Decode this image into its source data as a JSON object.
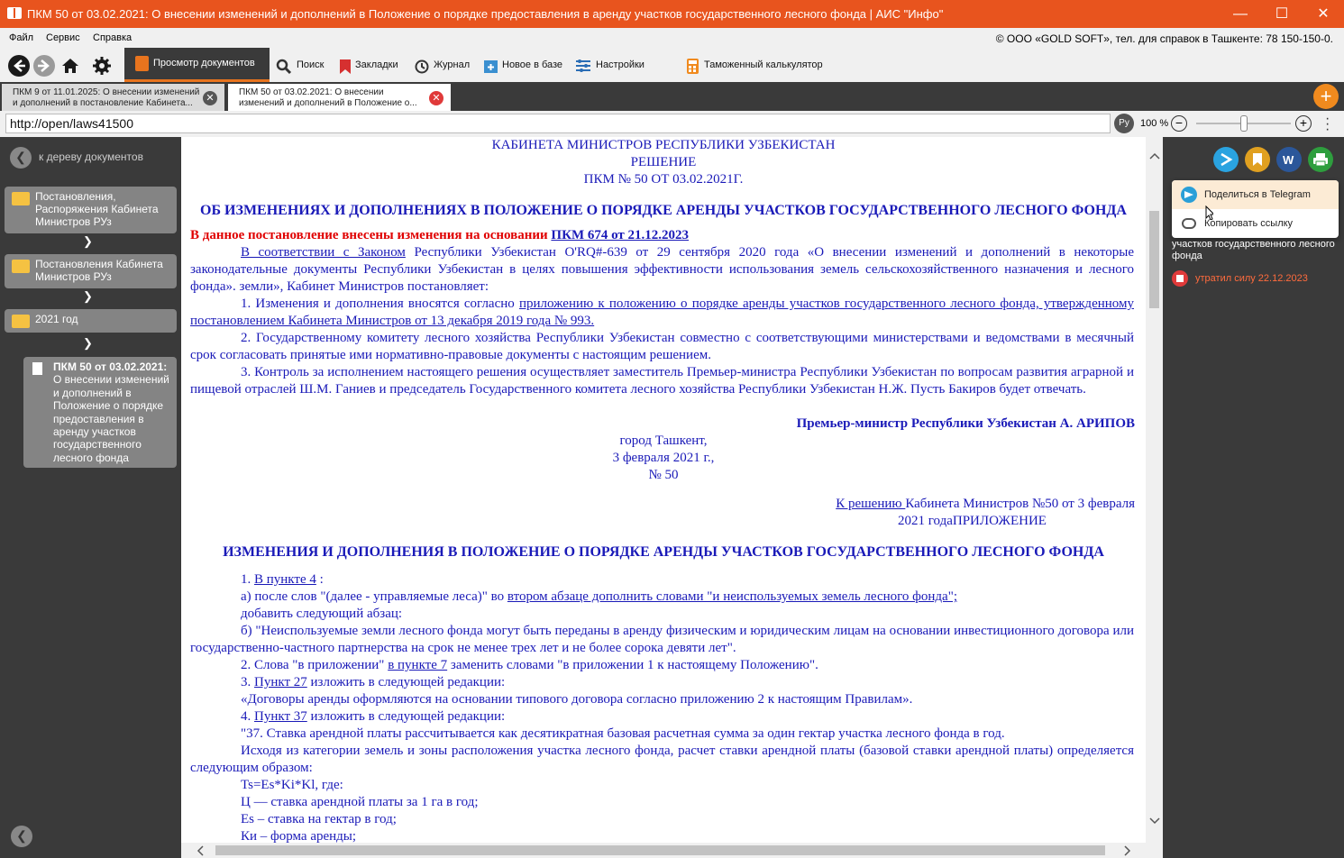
{
  "window": {
    "title": "ПКМ 50 от 03.02.2021: О внесении изменений и дополнений в Положение о порядке предоставления в аренду участков государственного лесного фонда   |   АИС \"Инфо\"",
    "minimize": "—",
    "maximize": "☐",
    "close": "✕"
  },
  "menu": {
    "items": [
      "Файл",
      "Сервис",
      "Справка"
    ],
    "copyright": "© ООО «GOLD SOFT», тел. для справок в Ташкенте: 78 150-150-0."
  },
  "toolbar": {
    "view_docs": "Просмотр документов",
    "search": "Поиск",
    "bookmarks": "Закладки",
    "journal": "Журнал",
    "new_in_base": "Новое в базе",
    "settings": "Настройки",
    "customs_calc": "Таможенный калькулятор"
  },
  "tabs": [
    {
      "line1": "ПКМ 9 от 11.01.2025: О внесении изменений",
      "line2": "и дополнений в постановление Кабинета..."
    },
    {
      "line1": "ПКМ 50 от 03.02.2021: О внесении",
      "line2": "изменений и дополнений в Положение о..."
    }
  ],
  "address": {
    "url": "http://open/laws41500",
    "lang": "Ру",
    "zoom": "100 %",
    "zoom_level": 0.5
  },
  "left_panel": {
    "back_to_tree": "к дереву документов",
    "nodes": [
      "Постановления, Распоряжения Кабинета Министров РУз",
      "Постановления Кабинета Министров РУз",
      "2021 год"
    ],
    "doc_title_bold": "ПКМ 50 от 03.02.2021:",
    "doc_title_rest": "О внесении изменений и дополнений в Положение о порядке предоставления в аренду участков государственного лесного фонда"
  },
  "document": {
    "header1": "КАБИНЕТА МИНИСТРОВ РЕСПУБЛИКИ УЗБЕКИСТАН",
    "header2": "РЕШЕНИЕ",
    "header3": "ПКМ № 50 ОТ 03.02.2021Г.",
    "title": "ОБ ИЗМЕНЕНИЯХ И ДОПОЛНЕНИЯХ В ПОЛОЖЕНИЕ О ПОРЯДКЕ АРЕНДЫ УЧАСТКОВ ГОСУДАРСТВЕННОГО ЛЕСНОГО ФОНДА",
    "changed_note": "В данное постановление внесены изменения на основании",
    "changed_link": "ПКМ 674 от 21.12.2023",
    "intro_link": "В соответствии с Законом",
    "intro_rest": " Республики Узбекистан O'RQ#-639 от 29 сентября 2020 года «О внесении изменений и дополнений в некоторые законодательные документы Республики Узбекистан в целях повышения эффективности использования земель сельскохозяйственного назначения и лесного фонда». земли», Кабинет Министров постановляет:",
    "p1_text": "1. Изменения и дополнения вносятся согласно ",
    "p1_link": "приложению к положению о порядке аренды участков государственного лесного фонда, утвержденному постановлением Кабинета Министров от 13 декабря 2019 года № 993.",
    "p2": "2. Государственному комитету лесного хозяйства Республики Узбекистан совместно с соответствующими министерствами и ведомствами в месячный срок согласовать принятые ими нормативно-правовые документы с настоящим решением.",
    "p3": "3. Контроль за исполнением настоящего решения осуществляет заместитель Премьер-министра Республики Узбекистан по вопросам развития аграрной и пищевой отраслей Ш.М. Ганиев и председатель Государственного комитета лесного хозяйства Республики Узбекистан Н.Ж. Пусть Бакиров будет отвечать.",
    "signature": "Премьер-министр Республики Узбекистан А. АРИПОВ",
    "city": "город Ташкент,",
    "date": "3 февраля 2021 г.,",
    "number": "№ 50",
    "annex_link": "К решению ",
    "annex_rest": "Кабинета Министров №50 от 3 февраля",
    "annex_line2": "2021 годаПРИЛОЖЕНИЕ",
    "title2": "ИЗМЕНЕНИЯ И ДОПОЛНЕНИЯ В ПОЛОЖЕНИЕ О ПОРЯДКЕ АРЕНДЫ УЧАСТКОВ ГОСУДАРСТВЕННОГО ЛЕСНОГО ФОНДА",
    "i1_pre": "1. ",
    "i1_link": "В пункте 4",
    "i1_post": " :",
    "ia_pre": "а) после слов \"(далее - управляемые леса)\" во ",
    "ia_link": "втором абзаце дополнить словами \"и неиспользуемых земель лесного фонда\";",
    "add_para": "добавить следующий абзац:",
    "ib": "б) \"Неиспользуемые земли лесного фонда могут быть переданы в аренду физическим и юридическим лицам на основании инвестиционного договора или государственно-частного партнерства на срок не менее трех лет и не более сорока девяти лет\".",
    "i2_pre": "2. Слова \"в приложении\" ",
    "i2_link": "в пункте 7",
    "i2_post": " заменить словами \"в приложении 1 к настоящему Положению\".",
    "i3_pre": "3. ",
    "i3_link": "Пункт 27",
    "i3_post": " изложить в следующей редакции:",
    "i3_quote": "«Договоры аренды оформляются на основании типового договора согласно приложению 2 к настоящим Правилам».",
    "i4_pre": "4. ",
    "i4_link": "Пункт 37",
    "i4_post": " изложить в следующей редакции:",
    "i4_37": "\"37. Ставка арендной платы рассчитывается как десятикратная базовая расчетная сумма за один гектар участка лесного фонда в год.",
    "i4_calc": "Исходя из категории земель и зоны расположения участка лесного фонда, расчет ставки арендной платы (базовой ставки арендной платы) определяется следующим образом:",
    "formula": "Ts=Es*Ki*Kl, где:",
    "f1": "Ц — ставка арендной платы за 1 га в год;",
    "f2": "Es – ставка на гектар в год;",
    "f3": "Ки – форма аренды;"
  },
  "right_panel": {
    "share_telegram": "Поделиться в Telegram",
    "copy_link": "Копировать ссылку",
    "text_trunc": "у",
    "text": "участков государственного лесного фонда",
    "expired": "утратил силу 22.12.2023"
  },
  "colors": {
    "accent": "#e8541e",
    "doc_text": "#1a1ab8",
    "red_note": "#e00000",
    "panel_bg": "#3a3a3a"
  }
}
